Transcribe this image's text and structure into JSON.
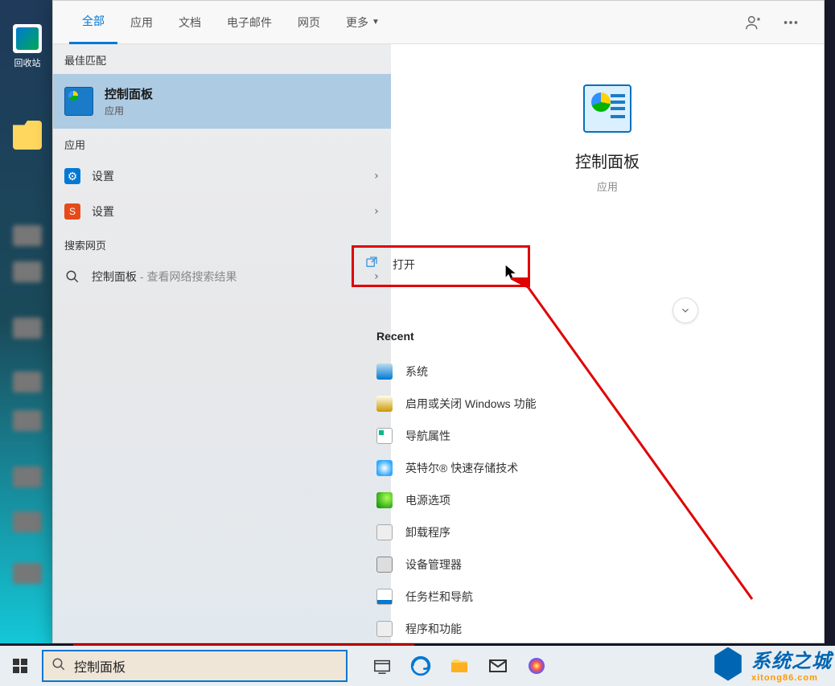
{
  "desktop": {
    "recycleBin": "回收站"
  },
  "tabs": {
    "all": "全部",
    "apps": "应用",
    "docs": "文档",
    "email": "电子邮件",
    "web": "网页",
    "more": "更多"
  },
  "left": {
    "bestMatchHeader": "最佳匹配",
    "bestMatch": {
      "title": "控制面板",
      "subtitle": "应用"
    },
    "appsHeader": "应用",
    "items": [
      {
        "icon": "gear-blue",
        "label": "设置"
      },
      {
        "icon": "gear-orange",
        "label": "设置"
      }
    ],
    "webHeader": "搜索网页",
    "webItem": {
      "label": "控制面板",
      "sub": " - 查看网络搜索结果"
    }
  },
  "right": {
    "title": "控制面板",
    "subtitle": "应用",
    "openLabel": "打开",
    "recentHeader": "Recent",
    "items": [
      {
        "icon": "ri-sys",
        "label": "系统"
      },
      {
        "icon": "ri-feat",
        "label": "启用或关闭 Windows 功能"
      },
      {
        "icon": "ri-adapt",
        "label": "导航属性"
      },
      {
        "icon": "ri-intel",
        "label": "英特尔® 快速存储技术"
      },
      {
        "icon": "ri-power",
        "label": "电源选项"
      },
      {
        "icon": "ri-uninst",
        "label": "卸载程序"
      },
      {
        "icon": "ri-devmgr",
        "label": "设备管理器"
      },
      {
        "icon": "ri-taskbar",
        "label": "任务栏和导航"
      },
      {
        "icon": "ri-prog",
        "label": "程序和功能"
      }
    ]
  },
  "taskbar": {
    "searchValue": "控制面板"
  },
  "watermark": {
    "cn": "系统之城",
    "en": "xitong86.com"
  }
}
